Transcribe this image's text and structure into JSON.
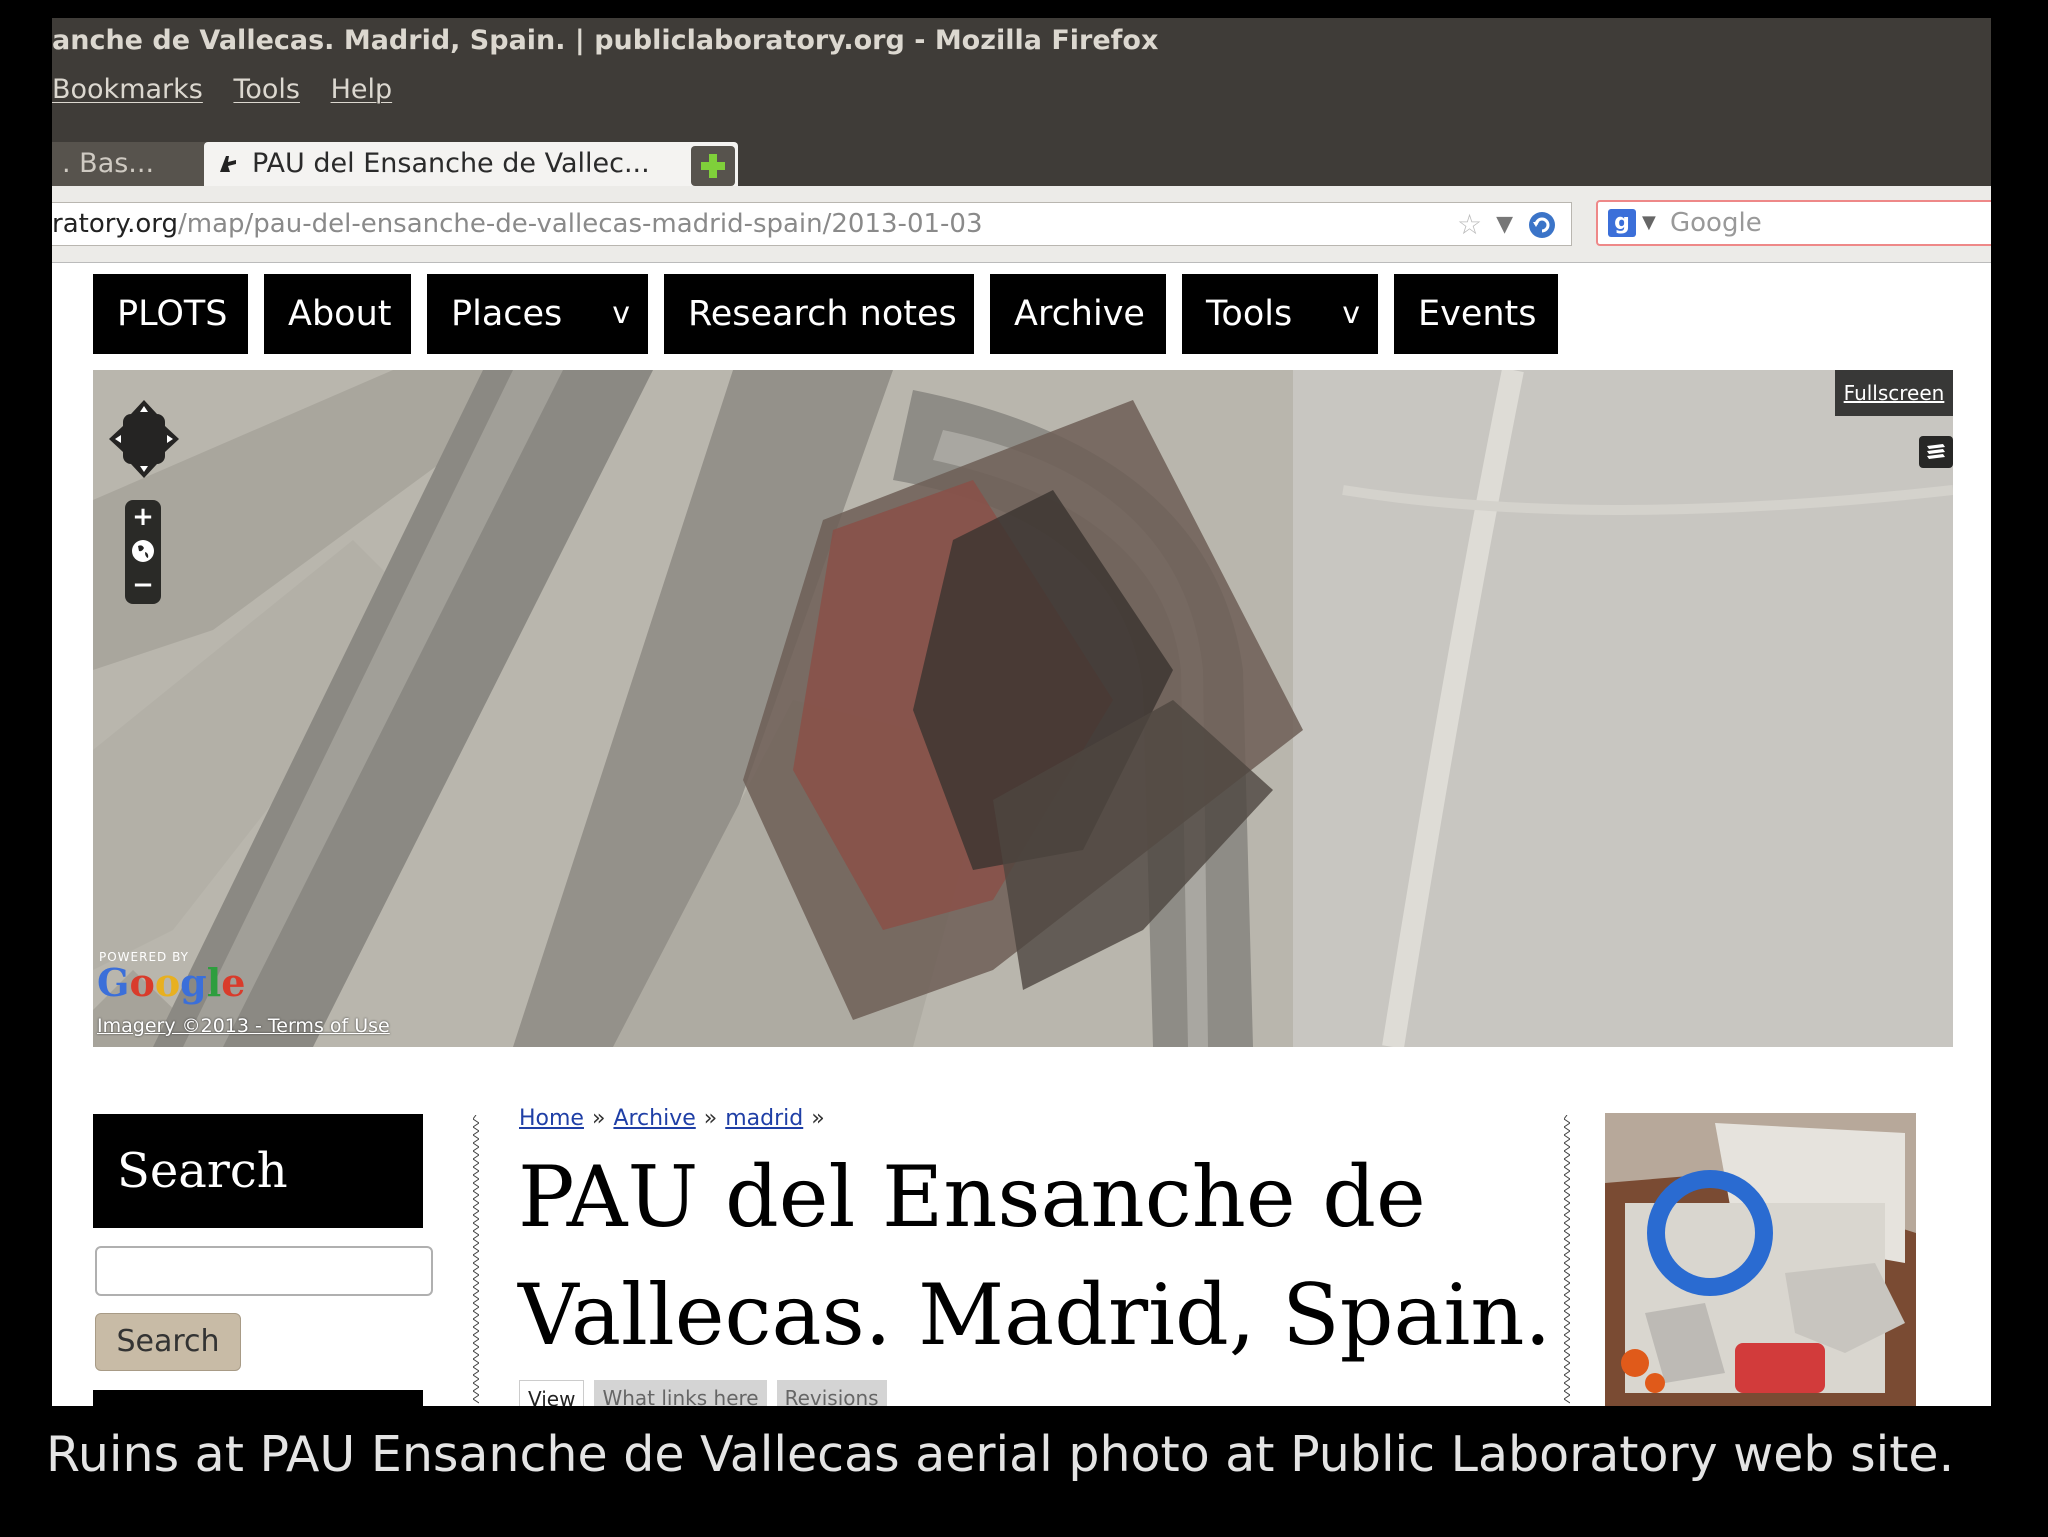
{
  "window": {
    "title": "anche de Vallecas. Madrid, Spain. | publiclaboratory.org - Mozilla Firefox"
  },
  "menubar": {
    "items": [
      "Bookmarks",
      "Tools",
      "Help"
    ]
  },
  "tabs": {
    "inactive_label": ". Bas...",
    "active_label": "PAU del Ensanche de Vallec..."
  },
  "navbar": {
    "url_host": "ratory.org",
    "url_path": "/map/pau-del-ensanche-de-vallecas-madrid-spain/2013-01-03",
    "search_placeholder": "Google"
  },
  "site_nav": {
    "items": [
      {
        "label": "PLOTS"
      },
      {
        "label": "About"
      },
      {
        "label": "Places",
        "chevron": "v"
      },
      {
        "label": "Research notes"
      },
      {
        "label": "Archive"
      },
      {
        "label": "Tools",
        "chevron": "v"
      },
      {
        "label": "Events"
      }
    ]
  },
  "map": {
    "fullscreen_label": "Fullscreen",
    "powered_by": "POWERED BY",
    "logo_letters": [
      "G",
      "o",
      "o",
      "g",
      "l",
      "e"
    ],
    "imagery_text": "Imagery ©2013 - Terms of Use",
    "zoom_in": "+",
    "zoom_out": "−"
  },
  "sidebar": {
    "search_title": "Search",
    "search_button": "Search"
  },
  "breadcrumb": {
    "items": [
      "Home",
      "Archive",
      "madrid"
    ],
    "separator": "»"
  },
  "page": {
    "title": "PAU del Ensanche de Vallecas. Madrid, Spain.",
    "tabs": [
      "View",
      "What links here",
      "Revisions"
    ]
  },
  "caption": "Ruins at PAU Ensanche de Vallecas aerial photo at Public Laboratory web site."
}
